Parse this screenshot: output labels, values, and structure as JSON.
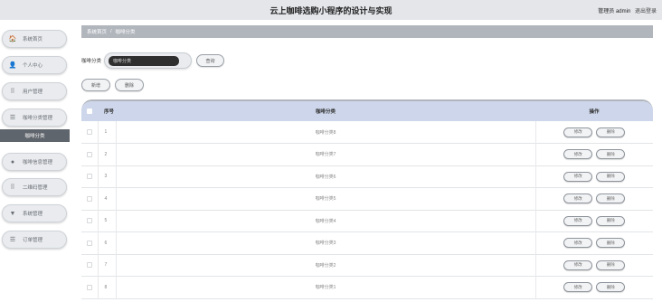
{
  "header": {
    "title": "云上咖啡选购小程序的设计与实现",
    "role_text": "管理员 admin",
    "logout_label": "退出登录"
  },
  "sidebar": {
    "items": [
      {
        "label": "系统首页",
        "icon": "home-icon",
        "glyph": "🏠"
      },
      {
        "label": "个人中心",
        "icon": "person-icon",
        "glyph": "👤"
      },
      {
        "label": "用户管理",
        "icon": "grid-icon",
        "glyph": "⠿"
      },
      {
        "label": "咖啡分类管理",
        "icon": "list-icon",
        "glyph": "☰"
      },
      {
        "label": "咖啡信息管理",
        "icon": "pin-icon",
        "glyph": "●"
      },
      {
        "label": "二维码管理",
        "icon": "grid-icon",
        "glyph": "⠿"
      },
      {
        "label": "系统管理",
        "icon": "filter-icon",
        "glyph": "▼"
      },
      {
        "label": "订单管理",
        "icon": "lines-icon",
        "glyph": "☰"
      }
    ],
    "active_sub": "咖啡分类"
  },
  "breadcrumb": {
    "home": "系统首页",
    "separator": "/",
    "current": "咖啡分类"
  },
  "search": {
    "label": "咖啡分类",
    "placeholder": "咖啡分类",
    "button": "查询"
  },
  "actions": {
    "add": "新增",
    "delete": "删除"
  },
  "table": {
    "headers": {
      "no": "序号",
      "name": "咖啡分类",
      "ops": "操作"
    },
    "rows": [
      {
        "no": "1",
        "name": "咖啡分类8"
      },
      {
        "no": "2",
        "name": "咖啡分类7"
      },
      {
        "no": "3",
        "name": "咖啡分类6"
      },
      {
        "no": "4",
        "name": "咖啡分类5"
      },
      {
        "no": "5",
        "name": "咖啡分类4"
      },
      {
        "no": "6",
        "name": "咖啡分类3"
      },
      {
        "no": "7",
        "name": "咖啡分类2"
      },
      {
        "no": "8",
        "name": "咖啡分类1"
      }
    ],
    "row_actions": {
      "edit": "修改",
      "delete": "删除"
    }
  },
  "colors": {
    "header_bg": "#e4e6ea",
    "breadcrumb_bg": "#b1b6bd",
    "active_sub_bg": "#5f656c",
    "table_head_bg": "#cdd6ea",
    "search_input_bg": "#2f2f2f"
  }
}
